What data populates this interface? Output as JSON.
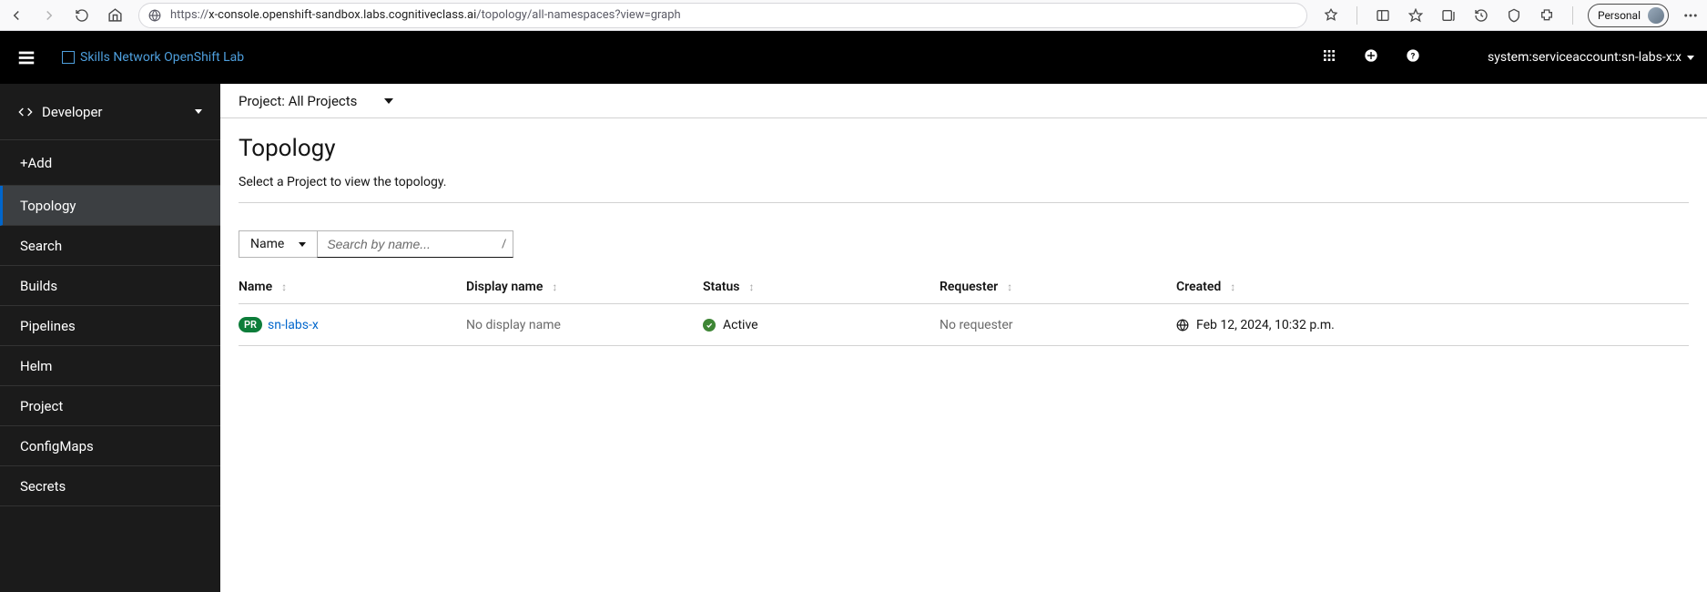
{
  "browser": {
    "url_prefix": "https://",
    "url_host": "x-console.openshift-sandbox.labs.cognitiveclass.ai",
    "url_path": "/topology/all-namespaces?view=graph",
    "profile_label": "Personal"
  },
  "header": {
    "logo_text": "Skills Network OpenShift Lab",
    "user_label": "system:serviceaccount:sn-labs-x:x"
  },
  "sidebar": {
    "perspective": "Developer",
    "items": [
      "+Add",
      "Topology",
      "Search",
      "Builds",
      "Pipelines",
      "Helm",
      "Project",
      "ConfigMaps",
      "Secrets"
    ],
    "active_index": 1
  },
  "project_bar": {
    "label": "Project: All Projects"
  },
  "page": {
    "title": "Topology",
    "description": "Select a Project to view the topology."
  },
  "filter": {
    "dropdown_label": "Name",
    "placeholder": "Search by name...",
    "shortcut": "/"
  },
  "table": {
    "columns": [
      "Name",
      "Display name",
      "Status",
      "Requester",
      "Created"
    ],
    "rows": [
      {
        "badge": "PR",
        "name": "sn-labs-x",
        "display_name": "No display name",
        "status": "Active",
        "requester": "No requester",
        "created": "Feb 12, 2024, 10:32 p.m."
      }
    ]
  }
}
